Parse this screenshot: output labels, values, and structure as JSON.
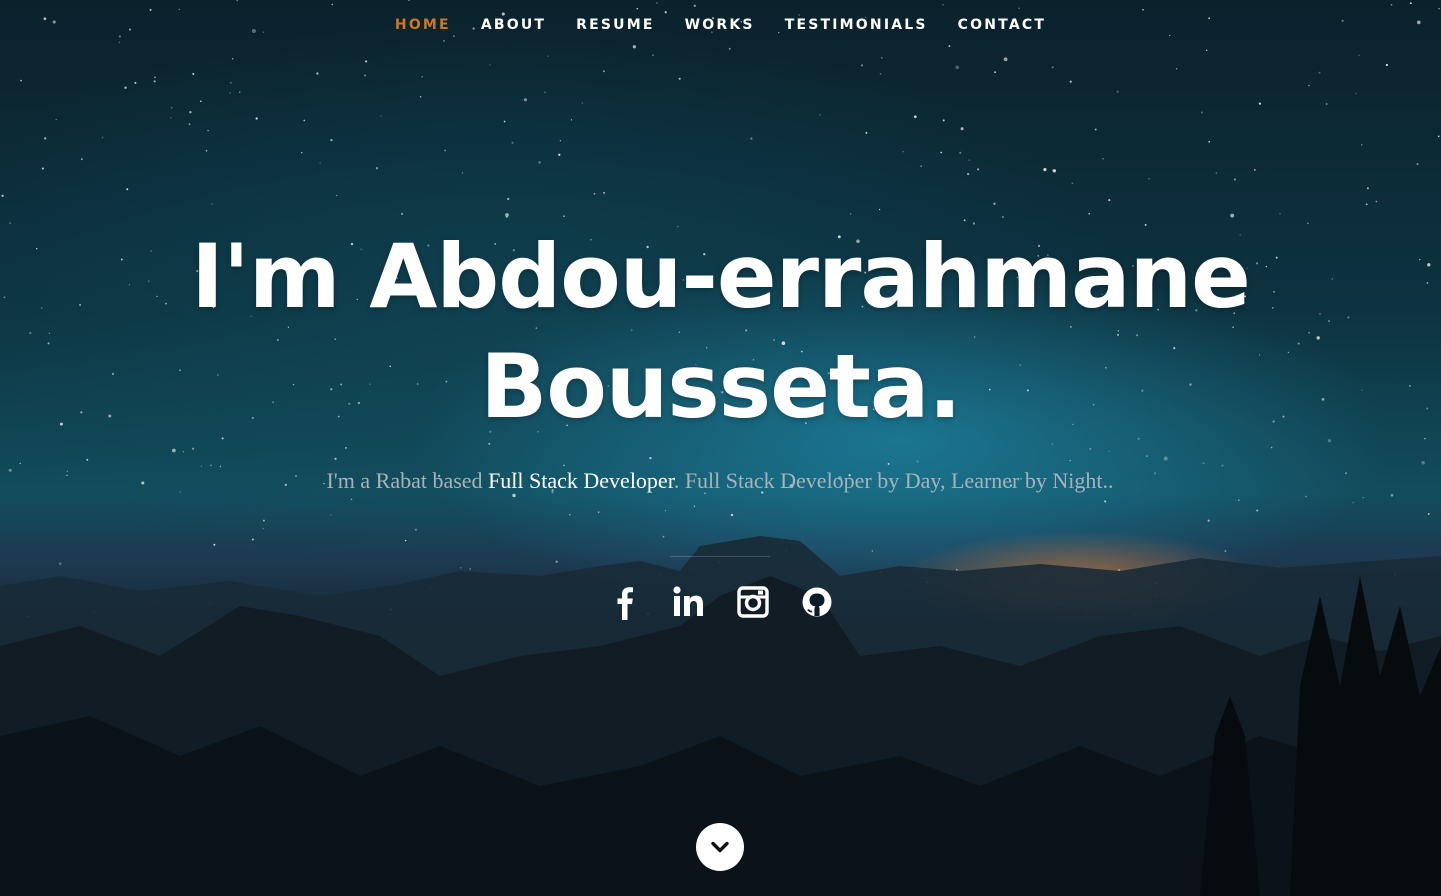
{
  "nav": {
    "items": [
      {
        "label": "HOME",
        "active": true
      },
      {
        "label": "ABOUT",
        "active": false
      },
      {
        "label": "RESUME",
        "active": false
      },
      {
        "label": "WORKS",
        "active": false
      },
      {
        "label": "TESTIMONIALS",
        "active": false
      },
      {
        "label": "CONTACT",
        "active": false
      }
    ],
    "active_color": "#d0761e"
  },
  "hero": {
    "headline_line1": "I'm Abdou-errahmane",
    "headline_line2": "Bousseta.",
    "tagline_prefix": "I'm a Rabat based ",
    "tagline_role": "Full Stack Developer",
    "tagline_suffix": ". Full Stack Developer by Day, Learner by Night.."
  },
  "social": [
    {
      "icon": "facebook-icon"
    },
    {
      "icon": "linkedin-icon"
    },
    {
      "icon": "instagram-icon"
    },
    {
      "icon": "github-icon"
    }
  ],
  "scroll_button": {
    "icon": "chevron-down-icon"
  }
}
